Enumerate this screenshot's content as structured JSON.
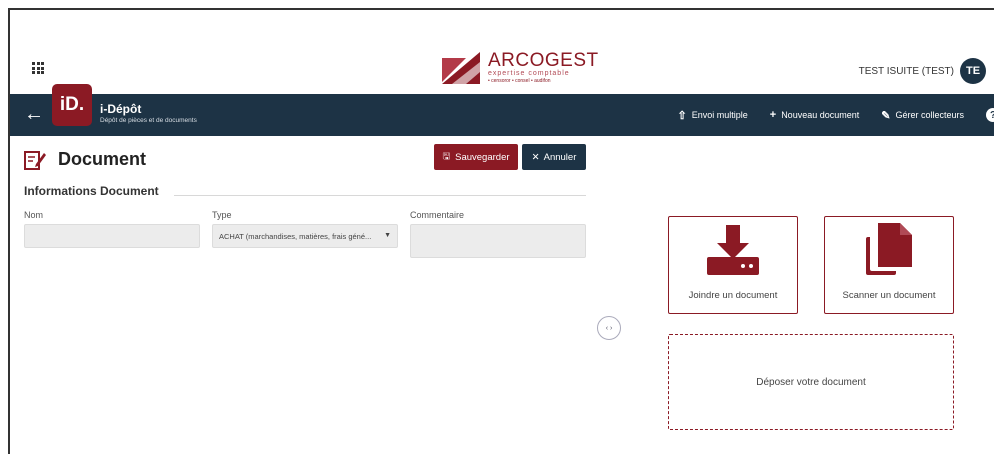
{
  "header": {
    "logo_name": "ARCOGEST",
    "logo_tagline": "expertise comptable",
    "logo_sub": "• censoror • consel • audifon",
    "user_name": "TEST ISUITE (TEST)",
    "user_initials": "TE"
  },
  "navbar": {
    "app_badge": "iD.",
    "app_title": "i-Dépôt",
    "app_subtitle": "Dépôt de pièces et de documents",
    "actions": [
      {
        "icon": "upload-icon",
        "label": "Envoi multiple"
      },
      {
        "icon": "plus-icon",
        "label": "Nouveau document"
      },
      {
        "icon": "edit-external-icon",
        "label": "Gérer collecteurs"
      }
    ]
  },
  "page": {
    "title": "Document",
    "save_label": "Sauvegarder",
    "cancel_label": "Annuler",
    "section_title": "Informations Document"
  },
  "form": {
    "nom_label": "Nom",
    "nom_value": "",
    "type_label": "Type",
    "type_value": "ACHAT (marchandises, matières, frais géné...",
    "commentaire_label": "Commentaire",
    "commentaire_value": ""
  },
  "upload": {
    "join_label": "Joindre un document",
    "scan_label": "Scanner un document",
    "drop_label": "Déposer votre document"
  },
  "colors": {
    "brand": "#8b1a24",
    "navbar": "#1d3345"
  }
}
